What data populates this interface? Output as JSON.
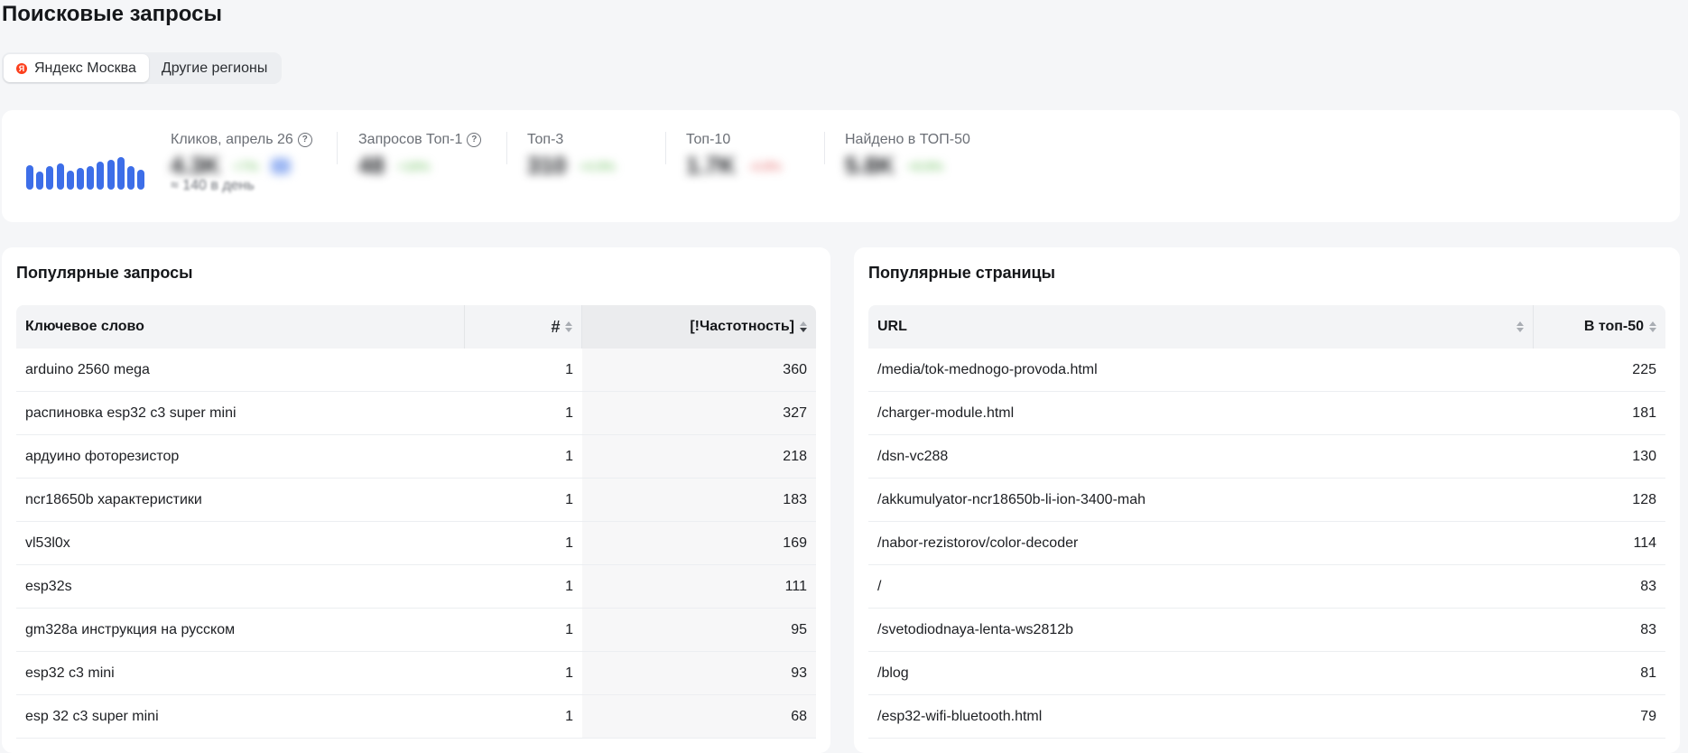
{
  "page": {
    "title": "Поисковые запросы"
  },
  "regions": [
    {
      "label": "Яндекс Москва",
      "active": true
    },
    {
      "label": "Другие регионы",
      "active": false
    }
  ],
  "sparkline_levels": [
    0.62,
    0.45,
    0.58,
    0.66,
    0.48,
    0.55,
    0.6,
    0.7,
    0.74,
    0.82,
    0.6,
    0.5
  ],
  "colors": {
    "accent": "#3d6ee8",
    "up": "#5ab84a",
    "down": "#e25656"
  },
  "stats": [
    {
      "label": "Кликов, апрель 26",
      "help": "?",
      "value": "4.3K",
      "delta": "+7%",
      "sub": "≈ 140 в день"
    },
    {
      "label": "Запросов Топ-1",
      "help": "?",
      "value": "48",
      "delta": "+16%"
    },
    {
      "label": "Топ-3",
      "value": "310",
      "delta": "+4.9%"
    },
    {
      "label": "Топ-10",
      "value": "1.7K",
      "delta": "-4.8%"
    },
    {
      "label": "Найдено в ТОП-50",
      "value": "5.8K",
      "delta": "+8.8%"
    }
  ],
  "queries": {
    "title": "Популярные запросы",
    "columns": {
      "keyword": "Ключевое слово",
      "position": "#",
      "frequency": "[!Частотность]"
    },
    "rows": [
      {
        "keyword": "arduino 2560 mega",
        "position": "1",
        "frequency": "360"
      },
      {
        "keyword": "распиновка esp32 c3 super mini",
        "position": "1",
        "frequency": "327"
      },
      {
        "keyword": "ардуино фоторезистор",
        "position": "1",
        "frequency": "218"
      },
      {
        "keyword": "ncr18650b характеристики",
        "position": "1",
        "frequency": "183"
      },
      {
        "keyword": "vl53l0x",
        "position": "1",
        "frequency": "169"
      },
      {
        "keyword": "esp32s",
        "position": "1",
        "frequency": "111"
      },
      {
        "keyword": "gm328a инструкция на русском",
        "position": "1",
        "frequency": "95"
      },
      {
        "keyword": "esp32 c3 mini",
        "position": "1",
        "frequency": "93"
      },
      {
        "keyword": "esp 32 c3 super mini",
        "position": "1",
        "frequency": "68"
      }
    ]
  },
  "pages": {
    "title": "Популярные страницы",
    "columns": {
      "url": "URL",
      "top50": "В топ-50"
    },
    "rows": [
      {
        "url": "/media/tok-mednogo-provoda.html",
        "top50": "225"
      },
      {
        "url": "/charger-module.html",
        "top50": "181"
      },
      {
        "url": "/dsn-vc288",
        "top50": "130"
      },
      {
        "url": "/akkumulyator-ncr18650b-li-ion-3400-mah",
        "top50": "128"
      },
      {
        "url": "/nabor-rezistorov/color-decoder",
        "top50": "114"
      },
      {
        "url": "/",
        "top50": "83"
      },
      {
        "url": "/svetodiodnaya-lenta-ws2812b",
        "top50": "83"
      },
      {
        "url": "/blog",
        "top50": "81"
      },
      {
        "url": "/esp32-wifi-bluetooth.html",
        "top50": "79"
      }
    ]
  }
}
